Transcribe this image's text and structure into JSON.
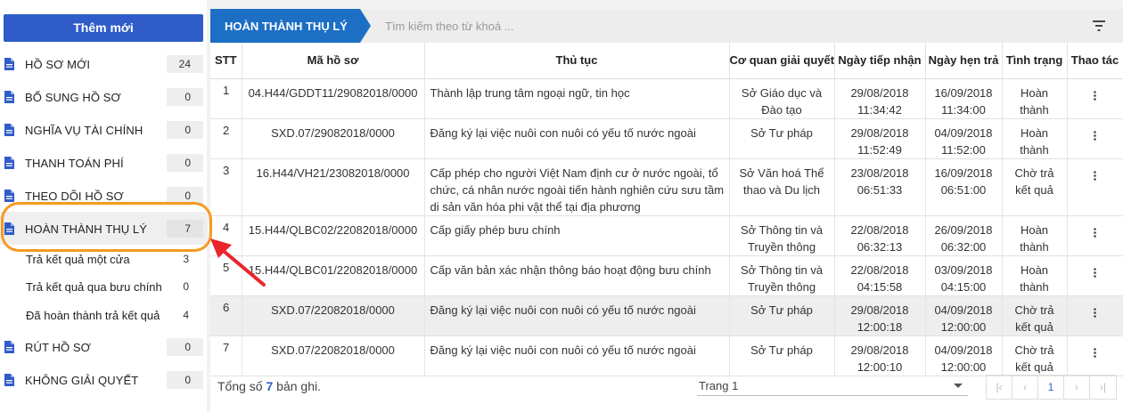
{
  "sidebar": {
    "add_button": "Thêm mới",
    "items": [
      {
        "label": "HỒ SƠ MỚI",
        "count": "24"
      },
      {
        "label": "BỔ SUNG HỒ SƠ",
        "count": "0"
      },
      {
        "label": "NGHĨA VỤ TÀI CHÍNH",
        "count": "0"
      },
      {
        "label": "THANH TOÁN PHÍ",
        "count": "0"
      },
      {
        "label": "THEO DÕI HỒ SƠ",
        "count": "0"
      },
      {
        "label": "HOÀN THÀNH THỤ LÝ",
        "count": "7"
      }
    ],
    "sub_items": [
      {
        "label": "Trả kết quả một cửa",
        "count": "3"
      },
      {
        "label": "Trả kết quả qua bưu chính",
        "count": "0"
      },
      {
        "label": "Đã hoàn thành trả kết quả",
        "count": "4"
      }
    ],
    "bottom_items": [
      {
        "label": "RÚT HỒ SƠ",
        "count": "0"
      },
      {
        "label": "KHÔNG GIẢI QUYẾT",
        "count": "0"
      }
    ]
  },
  "toolbar": {
    "status_tab": "HOÀN THÀNH THỤ LÝ",
    "search_placeholder": "Tìm kiếm theo từ khoá ..."
  },
  "table": {
    "headers": [
      "STT",
      "Mã hồ sơ",
      "Thủ tục",
      "Cơ quan giải quyết",
      "Ngày tiếp nhận",
      "Ngày hẹn trả",
      "Tình trạng",
      "Thao tác"
    ],
    "rows": [
      {
        "stt": "1",
        "ma": "04.H44/GDDT11/29082018/0000",
        "thutuc": "Thành lập trung tâm ngoại ngữ, tin học",
        "coquan": "Sở Giáo dục và Đào tạo",
        "tiepnhan_date": "29/08/2018",
        "tiepnhan_time": "11:34:42",
        "hentra_date": "16/09/2018",
        "hentra_time": "11:34:00",
        "tinhtrang": "Hoàn thành"
      },
      {
        "stt": "2",
        "ma": "SXD.07/29082018/0000",
        "thutuc": "Đăng ký lại việc nuôi con nuôi có yếu tố nước ngoài",
        "coquan": "Sở Tư pháp",
        "tiepnhan_date": "29/08/2018",
        "tiepnhan_time": "11:52:49",
        "hentra_date": "04/09/2018",
        "hentra_time": "11:52:00",
        "tinhtrang": "Hoàn thành"
      },
      {
        "stt": "3",
        "ma": "16.H44/VH21/23082018/0000",
        "thutuc": "Cấp phép cho người Việt Nam định cư ở nước ngoài, tổ chức, cá nhân nước ngoài tiến hành nghiên cứu sưu tầm di sản văn hóa phi vật thể tại địa phương",
        "coquan": "Sở Văn hoá Thể thao và Du lịch",
        "tiepnhan_date": "23/08/2018",
        "tiepnhan_time": "06:51:33",
        "hentra_date": "16/09/2018",
        "hentra_time": "06:51:00",
        "tinhtrang": "Chờ trả kết quả"
      },
      {
        "stt": "4",
        "ma": "15.H44/QLBC02/22082018/0000",
        "thutuc": "Cấp giấy phép bưu chính",
        "coquan": "Sở Thông tin và Truyền thông",
        "tiepnhan_date": "22/08/2018",
        "tiepnhan_time": "06:32:13",
        "hentra_date": "26/09/2018",
        "hentra_time": "06:32:00",
        "tinhtrang": "Hoàn thành"
      },
      {
        "stt": "5",
        "ma": "15.H44/QLBC01/22082018/0000",
        "thutuc": "Cấp văn bản xác nhận thông báo hoạt động bưu chính",
        "coquan": "Sở Thông tin và Truyền thông",
        "tiepnhan_date": "22/08/2018",
        "tiepnhan_time": "04:15:58",
        "hentra_date": "03/09/2018",
        "hentra_time": "04:15:00",
        "tinhtrang": "Hoàn thành"
      },
      {
        "stt": "6",
        "ma": "SXD.07/22082018/0000",
        "thutuc": "Đăng ký lại việc nuôi con nuôi có yếu tố nước ngoài",
        "coquan": "Sở Tư pháp",
        "tiepnhan_date": "29/08/2018",
        "tiepnhan_time": "12:00:18",
        "hentra_date": "04/09/2018",
        "hentra_time": "12:00:00",
        "tinhtrang": "Chờ trả kết quả"
      },
      {
        "stt": "7",
        "ma": "SXD.07/22082018/0000",
        "thutuc": "Đăng ký lại việc nuôi con nuôi có yếu tố nước ngoài",
        "coquan": "Sở Tư pháp",
        "tiepnhan_date": "29/08/2018",
        "tiepnhan_time": "12:00:10",
        "hentra_date": "04/09/2018",
        "hentra_time": "12:00:00",
        "tinhtrang": "Chờ trả kết quả"
      }
    ]
  },
  "footer": {
    "total_prefix": "Tổng số",
    "total_count": "7",
    "total_suffix": "bản ghi.",
    "page_select": "Trang 1",
    "current_page": "1"
  },
  "colors": {
    "accent": "#2f5cc8",
    "status_tab": "#1c6fc5",
    "highlight": "#f59a23",
    "arrow": "#e8262b"
  },
  "icons": {
    "nav": "document-icon",
    "filter": "filter-icon",
    "row_action": "more-vertical-icon"
  }
}
